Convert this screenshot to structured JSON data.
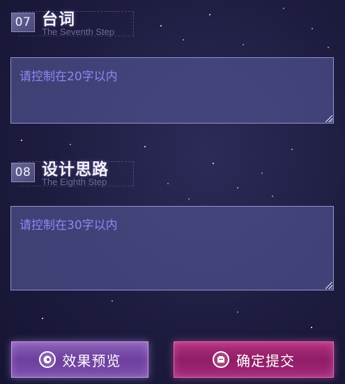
{
  "steps": [
    {
      "number": "07",
      "title": "台词",
      "subtitle": "The Seventh Step",
      "placeholder": "请控制在20字以内"
    },
    {
      "number": "08",
      "title": "设计思路",
      "subtitle": "The Eighth Step",
      "placeholder": "请控制在30字以内"
    }
  ],
  "buttons": {
    "preview_label": "效果预览",
    "submit_label": "确定提交",
    "preview_icon": "preview-eye-icon",
    "submit_icon": "submit-card-icon"
  },
  "colors": {
    "background": "#1d1c3f",
    "textbox_bg": "#4e508c",
    "textbox_border": "#9593cf",
    "placeholder": "#8b88f2",
    "preview_button": "#7a4fac",
    "submit_button": "#a2287a"
  }
}
